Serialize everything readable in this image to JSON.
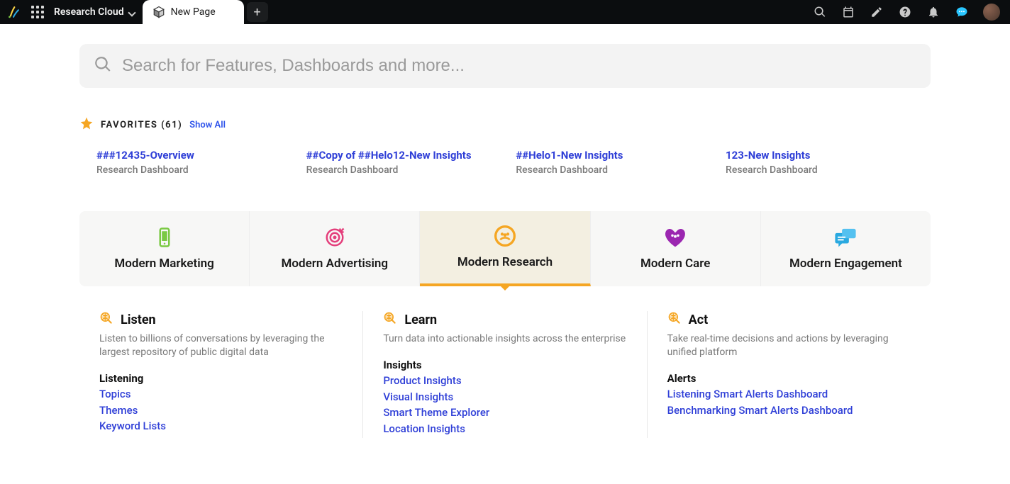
{
  "header": {
    "brand_title": "Research Cloud",
    "tab_label": "New Page"
  },
  "search": {
    "placeholder": "Search for Features, Dashboards and more..."
  },
  "favorites": {
    "heading": "FAVORITES (61)",
    "show_all": "Show All",
    "items": [
      {
        "title": "###12435-Overview",
        "subtitle": "Research Dashboard"
      },
      {
        "title": "##Copy of ##Helo12-New Insights",
        "subtitle": "Research Dashboard"
      },
      {
        "title": "##Helo1-New Insights",
        "subtitle": "Research Dashboard"
      },
      {
        "title": "123-New Insights",
        "subtitle": "Research Dashboard"
      }
    ]
  },
  "categories": {
    "items": [
      {
        "label": "Modern Marketing"
      },
      {
        "label": "Modern Advertising"
      },
      {
        "label": "Modern Research"
      },
      {
        "label": "Modern Care"
      },
      {
        "label": "Modern Engagement"
      }
    ],
    "active_index": 2
  },
  "columns": [
    {
      "title": "Listen",
      "desc": "Listen to billions of conversations by leveraging the largest repository of public digital data",
      "group_label": "Listening",
      "links": [
        "Topics",
        "Themes",
        "Keyword Lists"
      ]
    },
    {
      "title": "Learn",
      "desc": "Turn data into actionable insights across the enterprise",
      "group_label": "Insights",
      "links": [
        "Product Insights",
        "Visual Insights",
        "Smart Theme Explorer",
        "Location Insights"
      ]
    },
    {
      "title": "Act",
      "desc": "Take real-time decisions and actions by leveraging unified platform",
      "group_label": "Alerts",
      "links": [
        "Listening Smart Alerts Dashboard",
        "Benchmarking Smart Alerts Dashboard"
      ]
    }
  ]
}
